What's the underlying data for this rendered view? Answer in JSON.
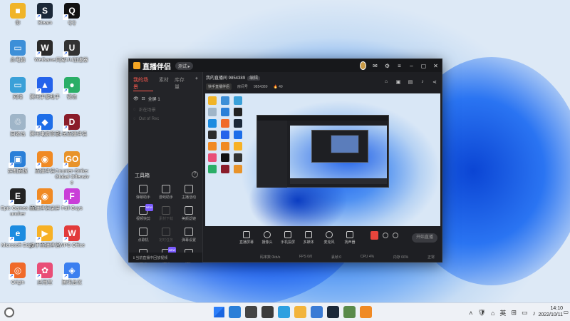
{
  "desktop": {
    "icons": [
      {
        "label": "你",
        "color": "#f0b429",
        "sym": "■",
        "col": 0,
        "row": 0
      },
      {
        "label": "此电脑",
        "color": "#3d8fd8",
        "sym": "▭",
        "col": 0,
        "row": 1
      },
      {
        "label": "网络",
        "color": "#3aa0d8",
        "sym": "▭",
        "col": 0,
        "row": 2
      },
      {
        "label": "回收站",
        "color": "#9fb5c8",
        "sym": "♲",
        "col": 0,
        "row": 3
      },
      {
        "label": "控制面板",
        "color": "#2a7fd8",
        "sym": "▣",
        "col": 0,
        "row": 4
      },
      {
        "label": "Epic Games Launcher",
        "color": "#222222",
        "sym": "E",
        "col": 0,
        "row": 5
      },
      {
        "label": "Microsoft Edge",
        "color": "#1b8be0",
        "sym": "e",
        "col": 0,
        "row": 6
      },
      {
        "label": "Origin",
        "color": "#f06a2a",
        "sym": "◎",
        "col": 0,
        "row": 7
      },
      {
        "label": "Steam",
        "color": "#1b2838",
        "sym": "S",
        "col": 1,
        "row": 0
      },
      {
        "label": "WeGame",
        "color": "#2b2b2b",
        "sym": "W",
        "col": 1,
        "row": 1
      },
      {
        "label": "腾讯手游助手",
        "color": "#2563eb",
        "sym": "▲",
        "col": 1,
        "row": 2
      },
      {
        "label": "腾讯电脑管家",
        "color": "#1e6ee8",
        "sym": "◆",
        "col": 1,
        "row": 3
      },
      {
        "label": "直播伴侣",
        "color": "#f08a24",
        "sym": "◉",
        "col": 1,
        "row": 4
      },
      {
        "label": "直播伴侣录屏",
        "color": "#f08a24",
        "sym": "◉",
        "col": 1,
        "row": 5
      },
      {
        "label": "快手直播伴侣",
        "color": "#f7b125",
        "sym": "▶",
        "col": 1,
        "row": 6
      },
      {
        "label": "应用宝",
        "color": "#e94e77",
        "sym": "✿",
        "col": 1,
        "row": 7
      },
      {
        "label": "QQ",
        "color": "#111111",
        "sym": "Q",
        "col": 2,
        "row": 0
      },
      {
        "label": "网易UU加速器",
        "color": "#333333",
        "sym": "U",
        "col": 2,
        "row": 1
      },
      {
        "label": "微信",
        "color": "#2aae67",
        "sym": "●",
        "col": 2,
        "row": 2
      },
      {
        "label": "斗鱼直播伴侣",
        "color": "#8a1c2a",
        "sym": "D",
        "col": 2,
        "row": 3
      },
      {
        "label": "Counter-Strike: Global Offensive",
        "color": "#e8932a",
        "sym": "GO",
        "col": 2,
        "row": 4
      },
      {
        "label": "Fall Guys",
        "color": "#c93ed8",
        "sym": "F",
        "col": 2,
        "row": 5
      },
      {
        "label": "WPS Office",
        "color": "#e23b3b",
        "sym": "W",
        "col": 2,
        "row": 6
      },
      {
        "label": "腾讯会议",
        "color": "#3b7ff0",
        "sym": "◈",
        "col": 2,
        "row": 7
      }
    ]
  },
  "window": {
    "title": "直播伴侣",
    "version_badge": "测试 ▸",
    "left_tabs": [
      "我的场景",
      "素材",
      "库存量"
    ],
    "scenes": [
      "全屏 1",
      "正在场景",
      "Out of Rec"
    ],
    "tools_title": "工具箱",
    "tools": [
      {
        "label": "弹幕助手",
        "dim": false,
        "new": false
      },
      {
        "label": "游戏助手",
        "dim": false,
        "new": false
      },
      {
        "label": "主播活动",
        "dim": false,
        "new": false
      },
      {
        "label": "视频快剪",
        "dim": false,
        "new": true
      },
      {
        "label": "素材下载",
        "dim": true,
        "new": false
      },
      {
        "label": "美颜滤镜",
        "dim": false,
        "new": false
      },
      {
        "label": "点歌机",
        "dim": false,
        "new": false
      },
      {
        "label": "定时任务",
        "dim": true,
        "new": false
      },
      {
        "label": "弹幕设置",
        "dim": false,
        "new": false
      },
      {
        "label": "互动",
        "dim": false,
        "new": false
      },
      {
        "label": "连麦",
        "dim": false,
        "new": true
      },
      {
        "label": "更多",
        "dim": false,
        "new": false
      }
    ],
    "left_footer": "ℹ 当前直播中回放视频",
    "room_title": "我的直播间 9854389",
    "room_edit": "编辑",
    "room_tag": "快手直播伴侣",
    "room_id_label": "房间号",
    "room_id": "9854389",
    "room_fire": "🔥 49",
    "bottom_controls": [
      {
        "label": "直播屏幕",
        "round": false
      },
      {
        "label": "摄像头",
        "round": true
      },
      {
        "label": "手机投屏",
        "round": false
      },
      {
        "label": "多媒体",
        "round": false
      },
      {
        "label": "麦克风",
        "round": true
      },
      {
        "label": "扬声器",
        "round": false
      }
    ],
    "live_button": "开始直播",
    "status": [
      "码率数 0kb/s",
      "FPS 0/0",
      "丢帧 0",
      "CPU 4%",
      "内存 66%",
      "正常"
    ]
  },
  "taskbar": {
    "apps": [
      "#2a7fd8",
      "#444444",
      "#3b3b3b",
      "#2ea0e0",
      "#f2b43c",
      "#3a7bd5",
      "#1b2838",
      "#5a8a4a",
      "#f08a24"
    ],
    "tray": [
      "˄",
      "🛡",
      "⌂",
      "英",
      "⊞",
      "▭",
      "♪"
    ],
    "time": "14:10",
    "date": "2022/10/11"
  }
}
